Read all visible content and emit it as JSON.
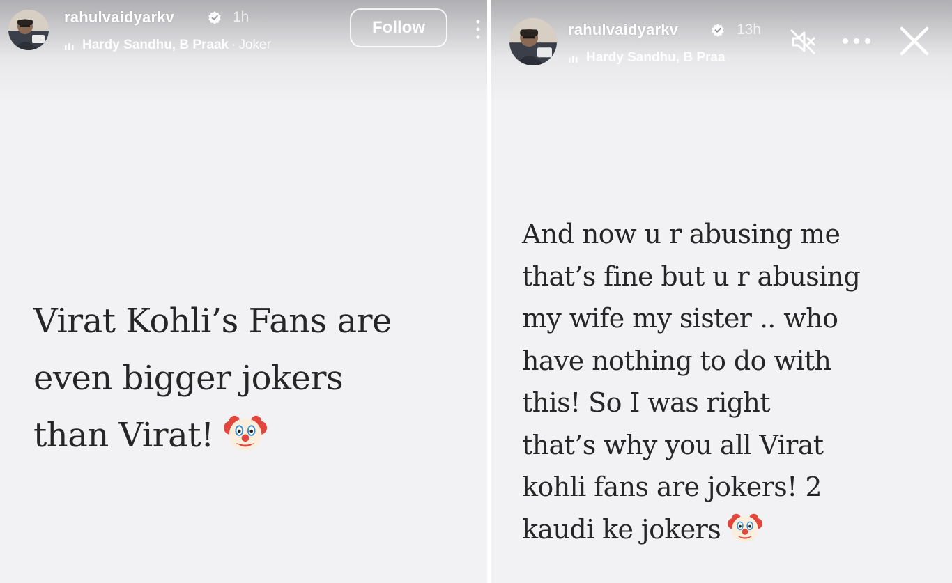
{
  "stories": {
    "left": {
      "username": "rahulvaidyarkv",
      "verified_icon": "verified-badge-icon",
      "time": "1h",
      "music": {
        "icon": "music-bars-icon",
        "artist": "Hardy Sandhu, B Praak",
        "separator": "·",
        "song": "Joker"
      },
      "follow_label": "Follow",
      "menu_icon": "kebab-menu-icon",
      "text_lines": [
        "Virat Kohli’s Fans are",
        "even bigger jokers",
        "than Virat!"
      ],
      "emoji": "clown-face-emoji"
    },
    "right": {
      "username": "rahulvaidyarkv",
      "verified_icon": "verified-badge-icon",
      "time": "13h",
      "music": {
        "icon": "music-bars-icon",
        "artist": "Hardy Sandhu, B Praa"
      },
      "mute_icon": "muted-speaker-icon",
      "more_icon": "more-dots-icon",
      "close_icon": "close-icon",
      "text_lines": [
        "And now u r abusing me",
        "that’s fine but u r abusing",
        "my wife my sister .. who",
        "have nothing to do with",
        "this! So I was right",
        "that’s why you all Virat",
        "kohli fans are jokers! 2",
        "kaudi ke jokers"
      ],
      "emoji": "clown-face-emoji"
    }
  },
  "colors": {
    "story_background": "#f2f2f4",
    "text": "#262626",
    "header_text": "#ffffff"
  }
}
